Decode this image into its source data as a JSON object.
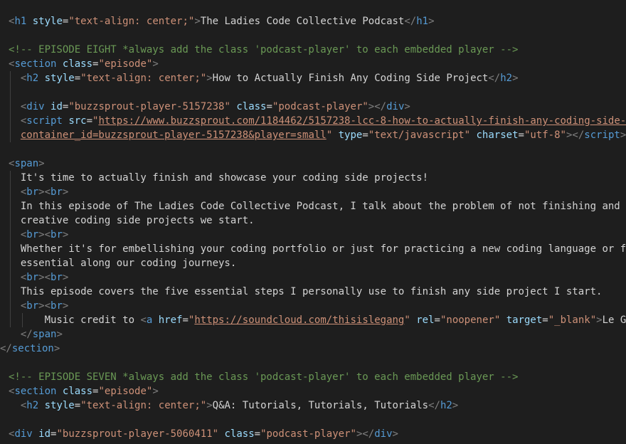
{
  "editor": {
    "colors": {
      "background": "#1e1e1e",
      "tag": "#569cd6",
      "attribute": "#9cdcfe",
      "string": "#ce9178",
      "text": "#d4d4d4",
      "comment": "#6a9955",
      "punctuation": "#808080"
    },
    "lines": [
      [
        {
          "t": "<",
          "k": "punc"
        },
        {
          "t": "h1",
          "k": "tag"
        },
        {
          "t": " ",
          "k": "text"
        },
        {
          "t": "style",
          "k": "attr"
        },
        {
          "t": "=",
          "k": "text"
        },
        {
          "t": "\"text-align: center;\"",
          "k": "str"
        },
        {
          "t": ">",
          "k": "punc"
        },
        {
          "t": "The Ladies Code Collective Podcast",
          "k": "text"
        },
        {
          "t": "</",
          "k": "punc"
        },
        {
          "t": "h1",
          "k": "tag"
        },
        {
          "t": ">",
          "k": "punc"
        }
      ],
      [],
      [
        {
          "t": "<!-- EPISODE EIGHT *always add the class 'podcast-player' to each embedded player -->",
          "k": "comment"
        }
      ],
      [
        {
          "t": "<",
          "k": "punc"
        },
        {
          "t": "section",
          "k": "tag"
        },
        {
          "t": " ",
          "k": "text"
        },
        {
          "t": "class",
          "k": "attr"
        },
        {
          "t": "=",
          "k": "text"
        },
        {
          "t": "\"episode\"",
          "k": "str"
        },
        {
          "t": ">",
          "k": "punc"
        }
      ],
      [
        {
          "t": "  ",
          "k": "text"
        },
        {
          "t": "<",
          "k": "punc"
        },
        {
          "t": "h2",
          "k": "tag"
        },
        {
          "t": " ",
          "k": "text"
        },
        {
          "t": "style",
          "k": "attr"
        },
        {
          "t": "=",
          "k": "text"
        },
        {
          "t": "\"text-align: center;\"",
          "k": "str"
        },
        {
          "t": ">",
          "k": "punc"
        },
        {
          "t": "How to Actually Finish Any Coding Side Project",
          "k": "text"
        },
        {
          "t": "</",
          "k": "punc"
        },
        {
          "t": "h2",
          "k": "tag"
        },
        {
          "t": ">",
          "k": "punc"
        }
      ],
      [],
      [
        {
          "t": "  ",
          "k": "text"
        },
        {
          "t": "<",
          "k": "punc"
        },
        {
          "t": "div",
          "k": "tag"
        },
        {
          "t": " ",
          "k": "text"
        },
        {
          "t": "id",
          "k": "attr"
        },
        {
          "t": "=",
          "k": "text"
        },
        {
          "t": "\"buzzsprout-player-5157238\"",
          "k": "str"
        },
        {
          "t": " ",
          "k": "text"
        },
        {
          "t": "class",
          "k": "attr"
        },
        {
          "t": "=",
          "k": "text"
        },
        {
          "t": "\"podcast-player\"",
          "k": "str"
        },
        {
          "t": ">",
          "k": "punc"
        },
        {
          "t": "</",
          "k": "punc"
        },
        {
          "t": "div",
          "k": "tag"
        },
        {
          "t": ">",
          "k": "punc"
        }
      ],
      [
        {
          "t": "  ",
          "k": "text"
        },
        {
          "t": "<",
          "k": "punc"
        },
        {
          "t": "script",
          "k": "tag"
        },
        {
          "t": " ",
          "k": "text"
        },
        {
          "t": "src",
          "k": "attr"
        },
        {
          "t": "=",
          "k": "text"
        },
        {
          "t": "\"",
          "k": "str"
        },
        {
          "t": "https://www.buzzsprout.com/1184462/5157238-lcc-8-how-to-actually-finish-any-coding-side-proje",
          "k": "link"
        }
      ],
      [
        {
          "t": "  ",
          "k": "text"
        },
        {
          "t": "container_id=buzzsprout-player-5157238&player=small",
          "k": "link"
        },
        {
          "t": "\"",
          "k": "str"
        },
        {
          "t": " ",
          "k": "text"
        },
        {
          "t": "type",
          "k": "attr"
        },
        {
          "t": "=",
          "k": "text"
        },
        {
          "t": "\"text/javascript\"",
          "k": "str"
        },
        {
          "t": " ",
          "k": "text"
        },
        {
          "t": "charset",
          "k": "attr"
        },
        {
          "t": "=",
          "k": "text"
        },
        {
          "t": "\"utf-8\"",
          "k": "str"
        },
        {
          "t": ">",
          "k": "punc"
        },
        {
          "t": "</",
          "k": "punc"
        },
        {
          "t": "script",
          "k": "tag"
        },
        {
          "t": ">",
          "k": "punc"
        }
      ],
      [],
      [
        {
          "t": "<",
          "k": "punc"
        },
        {
          "t": "span",
          "k": "tag"
        },
        {
          "t": ">",
          "k": "punc"
        }
      ],
      [
        {
          "t": "  It's time to actually finish and showcase your coding side projects!",
          "k": "text"
        }
      ],
      [
        {
          "t": "  ",
          "k": "text"
        },
        {
          "t": "<",
          "k": "punc"
        },
        {
          "t": "br",
          "k": "tag"
        },
        {
          "t": ">",
          "k": "punc"
        },
        {
          "t": "<",
          "k": "punc"
        },
        {
          "t": "br",
          "k": "tag"
        },
        {
          "t": ">",
          "k": "punc"
        }
      ],
      [
        {
          "t": "  In this episode of The Ladies Code Collective Podcast, I talk about the problem of not finishing and ultim",
          "k": "text"
        }
      ],
      [
        {
          "t": "  creative coding side projects we start.",
          "k": "text"
        }
      ],
      [
        {
          "t": "  ",
          "k": "text"
        },
        {
          "t": "<",
          "k": "punc"
        },
        {
          "t": "br",
          "k": "tag"
        },
        {
          "t": ">",
          "k": "punc"
        },
        {
          "t": "<",
          "k": "punc"
        },
        {
          "t": "br",
          "k": "tag"
        },
        {
          "t": ">",
          "k": "punc"
        }
      ],
      [
        {
          "t": "  Whether it's for embellishing your coding portfolio or just for practicing a new coding language or framew",
          "k": "text"
        }
      ],
      [
        {
          "t": "  essential along our coding journeys.",
          "k": "text"
        }
      ],
      [
        {
          "t": "  ",
          "k": "text"
        },
        {
          "t": "<",
          "k": "punc"
        },
        {
          "t": "br",
          "k": "tag"
        },
        {
          "t": ">",
          "k": "punc"
        },
        {
          "t": "<",
          "k": "punc"
        },
        {
          "t": "br",
          "k": "tag"
        },
        {
          "t": ">",
          "k": "punc"
        }
      ],
      [
        {
          "t": "  This episode covers the five essential steps I personally use to finish any side project I start.",
          "k": "text"
        }
      ],
      [
        {
          "t": "  ",
          "k": "text"
        },
        {
          "t": "<",
          "k": "punc"
        },
        {
          "t": "br",
          "k": "tag"
        },
        {
          "t": ">",
          "k": "punc"
        },
        {
          "t": "<",
          "k": "punc"
        },
        {
          "t": "br",
          "k": "tag"
        },
        {
          "t": ">",
          "k": "punc"
        }
      ],
      [
        {
          "t": "      Music credit to ",
          "k": "text"
        },
        {
          "t": "<",
          "k": "punc"
        },
        {
          "t": "a",
          "k": "tag"
        },
        {
          "t": " ",
          "k": "text"
        },
        {
          "t": "href",
          "k": "attr"
        },
        {
          "t": "=",
          "k": "text"
        },
        {
          "t": "\"",
          "k": "str"
        },
        {
          "t": "https://soundcloud.com/thisislegang",
          "k": "link"
        },
        {
          "t": "\"",
          "k": "str"
        },
        {
          "t": " ",
          "k": "text"
        },
        {
          "t": "rel",
          "k": "attr"
        },
        {
          "t": "=",
          "k": "text"
        },
        {
          "t": "\"noopener\"",
          "k": "str"
        },
        {
          "t": " ",
          "k": "text"
        },
        {
          "t": "target",
          "k": "attr"
        },
        {
          "t": "=",
          "k": "text"
        },
        {
          "t": "\"_blank\"",
          "k": "str"
        },
        {
          "t": ">",
          "k": "punc"
        },
        {
          "t": "Le Gang",
          "k": "text"
        },
        {
          "t": "</",
          "k": "punc"
        }
      ],
      [
        {
          "t": "  ",
          "k": "text"
        },
        {
          "t": "</",
          "k": "punc"
        },
        {
          "t": "span",
          "k": "tag"
        },
        {
          "t": ">",
          "k": "punc"
        }
      ],
      [
        {
          "t": "</",
          "k": "punc"
        },
        {
          "t": "section",
          "k": "tag"
        },
        {
          "t": ">",
          "k": "punc"
        }
      ],
      [],
      [
        {
          "t": "<!-- EPISODE SEVEN *always add the class 'podcast-player' to each embedded player -->",
          "k": "comment"
        }
      ],
      [
        {
          "t": "<",
          "k": "punc"
        },
        {
          "t": "section",
          "k": "tag"
        },
        {
          "t": " ",
          "k": "text"
        },
        {
          "t": "class",
          "k": "attr"
        },
        {
          "t": "=",
          "k": "text"
        },
        {
          "t": "\"episode\"",
          "k": "str"
        },
        {
          "t": ">",
          "k": "punc"
        }
      ],
      [
        {
          "t": "  ",
          "k": "text"
        },
        {
          "t": "<",
          "k": "punc"
        },
        {
          "t": "h2",
          "k": "tag"
        },
        {
          "t": " ",
          "k": "text"
        },
        {
          "t": "style",
          "k": "attr"
        },
        {
          "t": "=",
          "k": "text"
        },
        {
          "t": "\"text-align: center;\"",
          "k": "str"
        },
        {
          "t": ">",
          "k": "punc"
        },
        {
          "t": "Q&A: Tutorials, Tutorials, Tutorials",
          "k": "text"
        },
        {
          "t": "</",
          "k": "punc"
        },
        {
          "t": "h2",
          "k": "tag"
        },
        {
          "t": ">",
          "k": "punc"
        }
      ],
      [],
      [
        {
          "t": "<",
          "k": "punc"
        },
        {
          "t": "div",
          "k": "tag"
        },
        {
          "t": " ",
          "k": "text"
        },
        {
          "t": "id",
          "k": "attr"
        },
        {
          "t": "=",
          "k": "text"
        },
        {
          "t": "\"buzzsprout-player-5060411\"",
          "k": "str"
        },
        {
          "t": " ",
          "k": "text"
        },
        {
          "t": "class",
          "k": "attr"
        },
        {
          "t": "=",
          "k": "text"
        },
        {
          "t": "\"podcast-player\"",
          "k": "str"
        },
        {
          "t": ">",
          "k": "punc"
        },
        {
          "t": "</",
          "k": "punc"
        },
        {
          "t": "div",
          "k": "tag"
        },
        {
          "t": ">",
          "k": "punc"
        }
      ]
    ]
  }
}
